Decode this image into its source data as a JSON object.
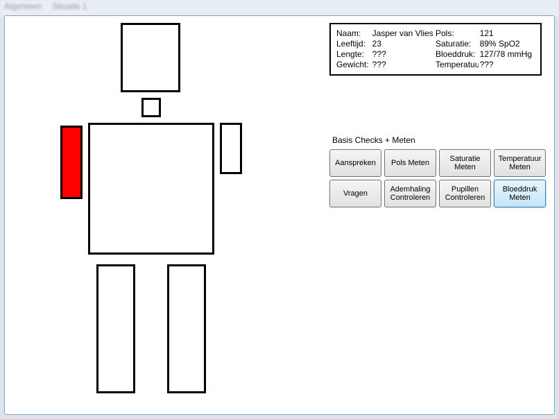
{
  "menu": {
    "item1": "Algemeen",
    "item2": "Situatie 1"
  },
  "patient": {
    "labels": {
      "name": "Naam:",
      "age": "Leeftijd:",
      "height": "Lengte:",
      "weight": "Gewicht:",
      "pulse": "Pols:",
      "saturation": "Saturatie:",
      "bp": "Bloeddruk:",
      "temp": "Temperatuur:"
    },
    "values": {
      "name": "Jasper van Vlies",
      "age": "23",
      "height": "???",
      "weight": "???",
      "pulse": "121",
      "saturation": "89% SpO2",
      "bp": "127/78 mmHg",
      "temp": "???"
    }
  },
  "group_title": "Basis Checks + Meten",
  "buttons": {
    "b1": "Aanspreken",
    "b2": "Pols Meten",
    "b3": "Saturatie Meten",
    "b4": "Temperatuur Meten",
    "b5": "Vragen",
    "b6": "Ademhaling Controleren",
    "b7": "Pupillen Controleren",
    "b8": "Bloeddruk Meten"
  },
  "figure": {
    "injured_part": "right-upper-arm"
  }
}
